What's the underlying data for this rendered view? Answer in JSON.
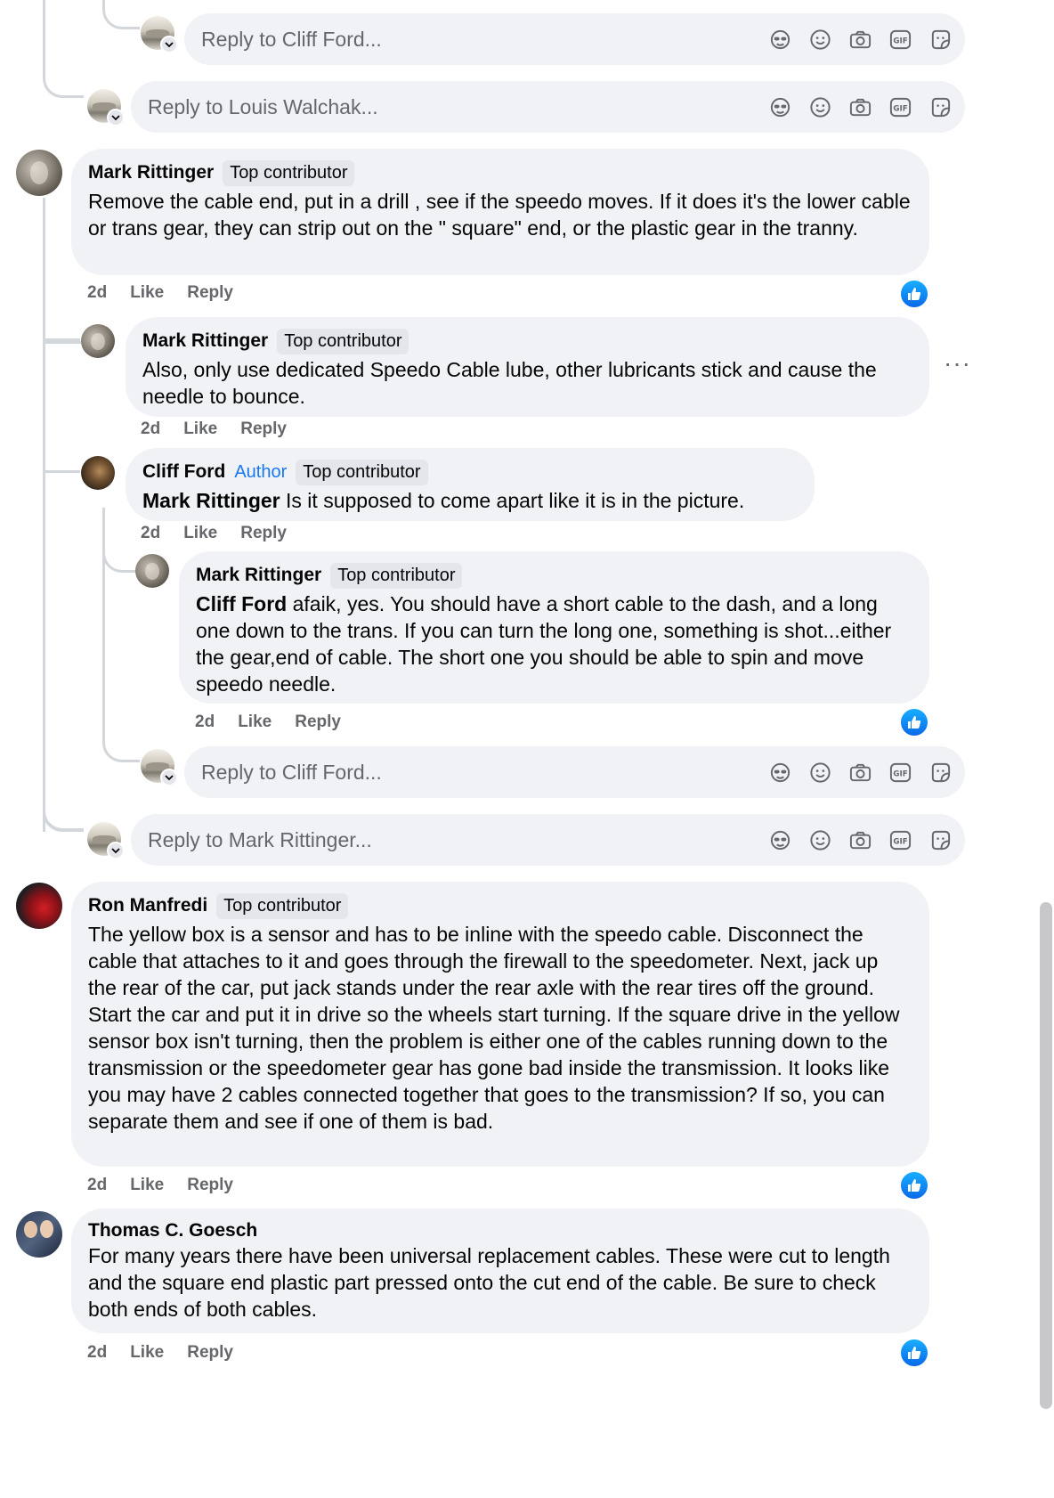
{
  "reply_icons": [
    "avatar-sticker-icon",
    "emoji-icon",
    "camera-icon",
    "gif-icon",
    "sticker-icon"
  ],
  "accent_like_color": "#1877f2",
  "reply_boxes": [
    {
      "placeholder": "Reply to Cliff Ford..."
    },
    {
      "placeholder": "Reply to Louis Walchak..."
    },
    {
      "placeholder": "Reply to Cliff Ford..."
    },
    {
      "placeholder": "Reply to Mark Rittinger..."
    }
  ],
  "comments": [
    {
      "author": "Mark Rittinger",
      "badges": [
        "Top contributor"
      ],
      "text": "Remove the cable end, put in a drill , see if the speedo moves. If it does it's the lower cable or trans gear, they can strip out on the \" square\" end, or the plastic gear in the tranny.",
      "time": "2d",
      "like": "Like",
      "reply": "Reply"
    },
    {
      "author": "Mark Rittinger",
      "badges": [
        "Top contributor"
      ],
      "text": "Also, only use dedicated Speedo Cable lube, other lubricants stick and cause the needle to bounce.",
      "time": "2d",
      "like": "Like",
      "reply": "Reply"
    },
    {
      "author": "Cliff Ford",
      "author_label": "Author",
      "badges": [
        "Top contributor"
      ],
      "mention": "Mark Rittinger",
      "text": " Is it supposed to come apart like it is in the picture.",
      "time": "2d",
      "like": "Like",
      "reply": "Reply"
    },
    {
      "author": "Mark Rittinger",
      "badges": [
        "Top contributor"
      ],
      "mention": "Cliff Ford",
      "text": " afaik, yes. You should have a short cable to the dash, and a long one down to the trans. If you can turn the long one, something is shot...either the gear,end of cable. The short one you should be able to spin and move speedo needle.",
      "time": "2d",
      "like": "Like",
      "reply": "Reply"
    },
    {
      "author": "Ron Manfredi",
      "badges": [
        "Top contributor"
      ],
      "text": "The yellow box is a sensor and has to be inline with the speedo cable. Disconnect the cable that attaches to it and goes through the firewall to the speedometer. Next, jack up the rear of the car, put jack stands under the rear axle with the rear tires off the ground. Start the car and put it in drive so the wheels start turning. If the square drive in the yellow sensor box isn't turning, then the problem is either one of the cables running down to the transmission or the speedometer gear has gone bad inside the transmission. It looks like you may have 2 cables connected together that goes to the transmission? If so, you can separate them and see if one of them is bad.",
      "time": "2d",
      "like": "Like",
      "reply": "Reply"
    },
    {
      "author": "Thomas C. Goesch",
      "badges": [],
      "text": "For many years there have been universal replacement cables. These were cut to length and the square end plastic part pressed onto the cut end of the cable. Be sure to check both ends of both cables.",
      "time": "2d",
      "like": "Like",
      "reply": "Reply"
    }
  ]
}
